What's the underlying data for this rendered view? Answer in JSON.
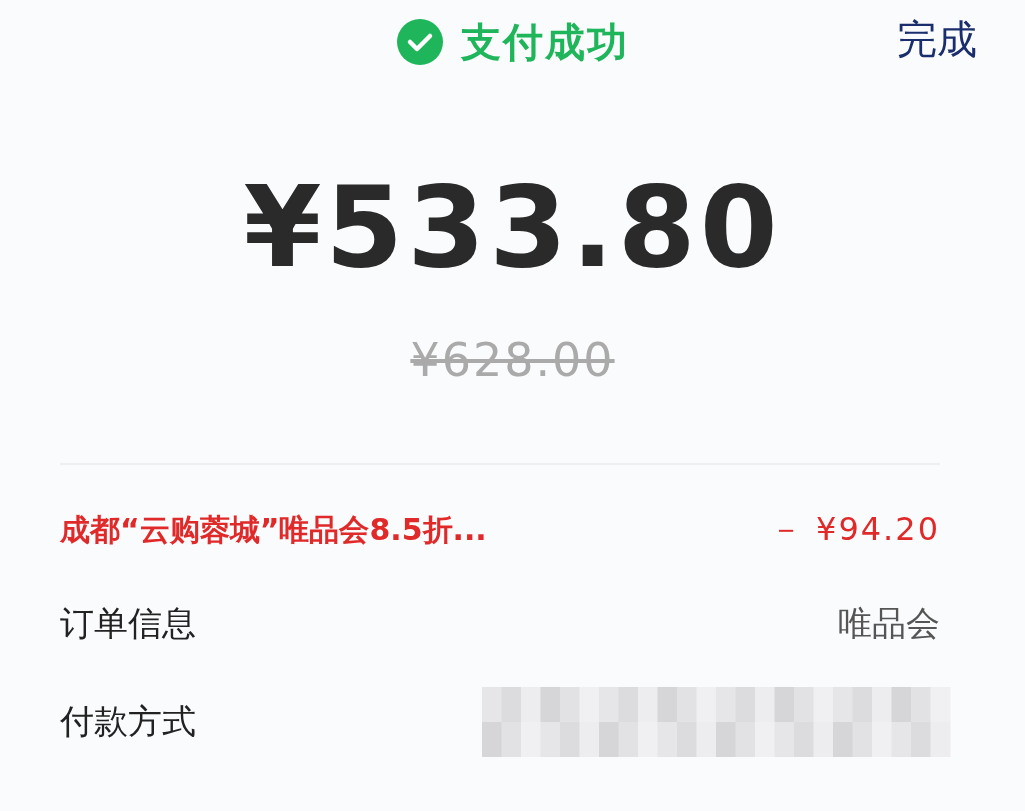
{
  "header": {
    "title": "支付成功",
    "done": "完成"
  },
  "amount": "¥533.80",
  "original_price": "¥628.00",
  "discount": {
    "label": "成都“云购蓉城”唯品会8.5折...",
    "value": "－ ¥94.20"
  },
  "rows": [
    {
      "label": "订单信息",
      "value": "唯品会",
      "kind": "text"
    },
    {
      "label": "付款方式",
      "kind": "hidden"
    }
  ]
}
